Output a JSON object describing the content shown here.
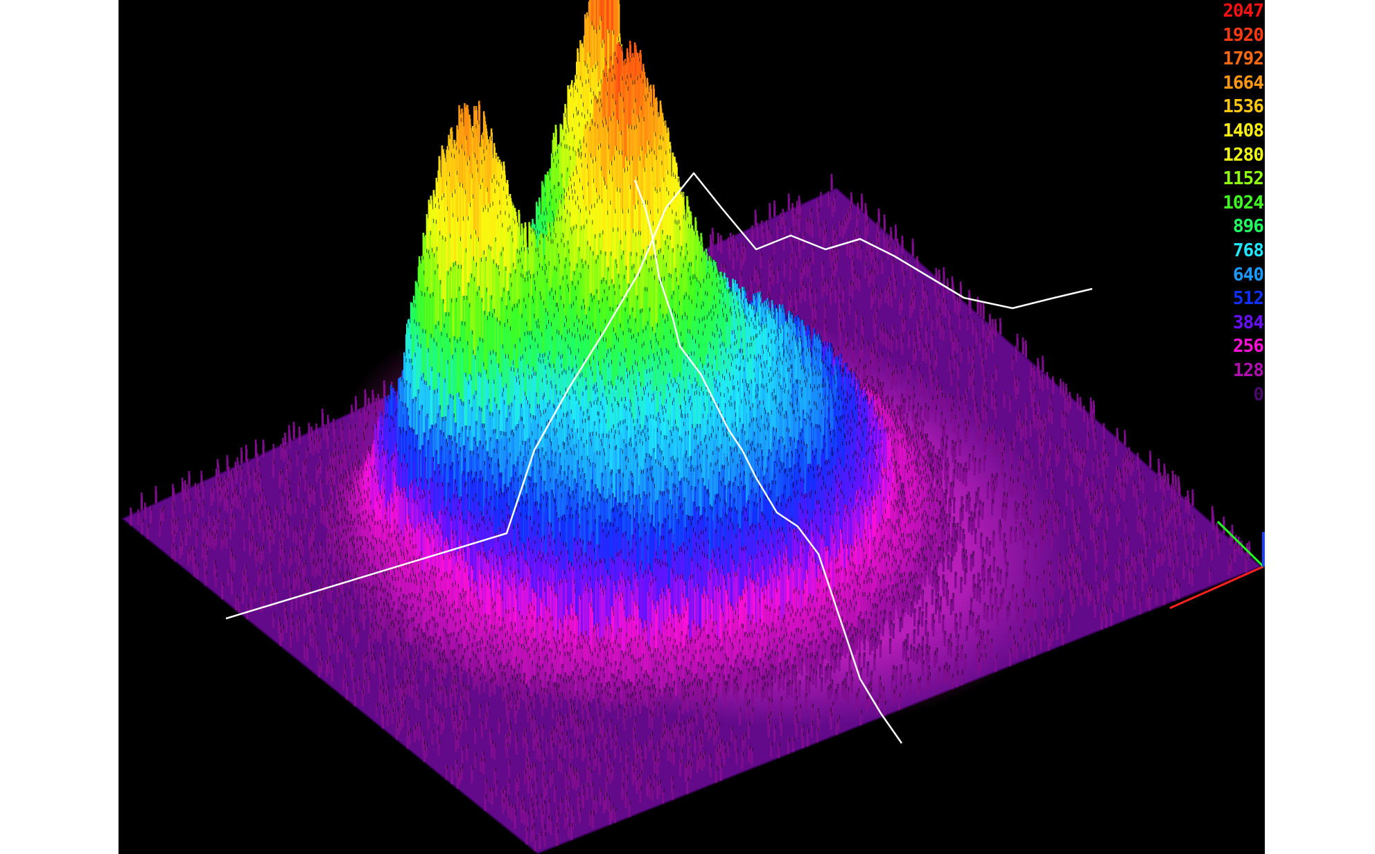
{
  "chart_data": {
    "type": "surface3d",
    "colorbar": {
      "placement": "top-right",
      "ticks": [
        {
          "label": "2047",
          "value": 2047,
          "color": "#ff1010"
        },
        {
          "label": "1920",
          "value": 1920,
          "color": "#ff3a10"
        },
        {
          "label": "1792",
          "value": 1792,
          "color": "#ff6a10"
        },
        {
          "label": "1664",
          "value": 1664,
          "color": "#ff9a10"
        },
        {
          "label": "1536",
          "value": 1536,
          "color": "#ffc810"
        },
        {
          "label": "1408",
          "value": 1408,
          "color": "#fff010"
        },
        {
          "label": "1280",
          "value": 1280,
          "color": "#f0ff10"
        },
        {
          "label": "1152",
          "value": 1152,
          "color": "#90ff10"
        },
        {
          "label": "1024",
          "value": 1024,
          "color": "#40ff20"
        },
        {
          "label": "896",
          "value": 896,
          "color": "#20ff60"
        },
        {
          "label": "768",
          "value": 768,
          "color": "#20e8ff"
        },
        {
          "label": "640",
          "value": 640,
          "color": "#1a9aff"
        },
        {
          "label": "512",
          "value": 512,
          "color": "#1030ff"
        },
        {
          "label": "384",
          "value": 384,
          "color": "#6a10ff"
        },
        {
          "label": "256",
          "value": 256,
          "color": "#ff10d8"
        },
        {
          "label": "128",
          "value": 128,
          "color": "#b010b0"
        },
        {
          "label": "0",
          "value": 0,
          "color": "#4a0a6a"
        }
      ]
    },
    "z_range": [
      0,
      2047
    ],
    "peaks": [
      {
        "u": 0.3,
        "v": 0.3,
        "height": 1990
      },
      {
        "u": 0.47,
        "v": 0.4,
        "height": 1860
      },
      {
        "u": 0.52,
        "v": 0.22,
        "height": 1750
      }
    ],
    "colors": {
      "background": "#000000",
      "outer_margin": "#ffffff",
      "profile_line": "#ffffff",
      "axis_x": "#ff2020",
      "axis_y": "#20ff20",
      "axis_z": "#2040ff"
    }
  }
}
